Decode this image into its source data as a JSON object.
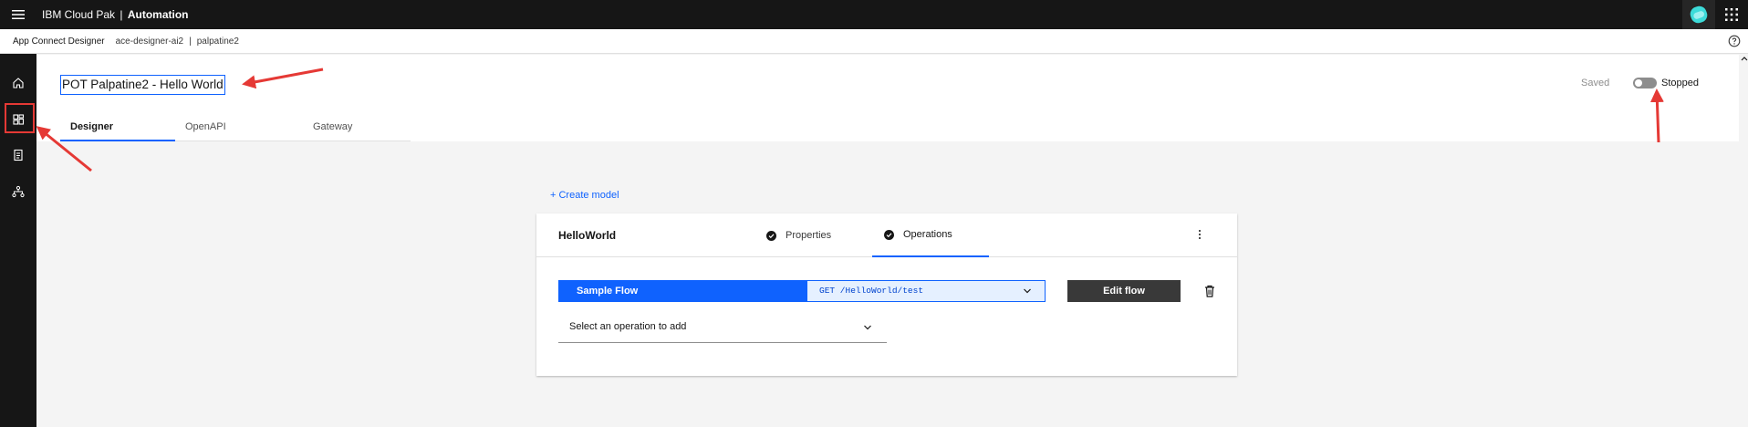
{
  "header": {
    "brand_name": "IBM Cloud Pak",
    "brand_sep": "|",
    "brand_product": "Automation",
    "icons": [
      "hamburger-menu-icon",
      "avatar-icon",
      "app-switcher-icon"
    ]
  },
  "subheader": {
    "app": "App Connect Designer",
    "instance": "ace-designer-ai2",
    "separator": "|",
    "namespace": "palpatine2",
    "help_icon": "help-icon"
  },
  "rail": {
    "items": [
      {
        "name": "home",
        "icon": "home-icon"
      },
      {
        "name": "dashboard",
        "icon": "dashboard-icon"
      },
      {
        "name": "catalog",
        "icon": "catalog-icon"
      },
      {
        "name": "hierarchy",
        "icon": "hierarchy-icon"
      }
    ]
  },
  "page": {
    "title": "POT Palpatine2 - Hello World",
    "saved": "Saved",
    "toggle_state": "Stopped",
    "tabs": [
      {
        "label": "Designer",
        "active": true
      },
      {
        "label": "OpenAPI",
        "active": false
      },
      {
        "label": "Gateway",
        "active": false
      }
    ]
  },
  "main": {
    "create_model": "+ Create model",
    "model": {
      "name": "HelloWorld",
      "tabs": [
        {
          "label": "Properties",
          "active": false
        },
        {
          "label": "Operations",
          "active": true
        }
      ],
      "flow": {
        "name": "Sample Flow",
        "operation": "GET /HelloWorld/test"
      },
      "edit_flow": "Edit flow",
      "select_placeholder": "Select an operation to add"
    }
  },
  "colors": {
    "accent": "#0f62fe",
    "header_bg": "#161616",
    "annotation": "#e53935"
  }
}
